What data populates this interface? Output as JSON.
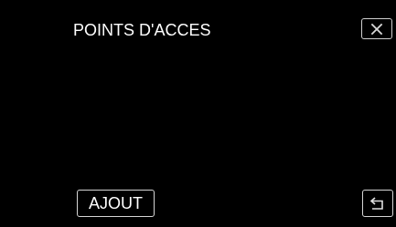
{
  "screen": {
    "title": "POINTS D'ACCES"
  },
  "buttons": {
    "add_label": "AJOUT",
    "close_icon": "close-icon",
    "back_icon": "return-arrow-icon"
  },
  "colors": {
    "background": "#000000",
    "text": "#ffffff",
    "button_border": "#d6d6d6"
  }
}
